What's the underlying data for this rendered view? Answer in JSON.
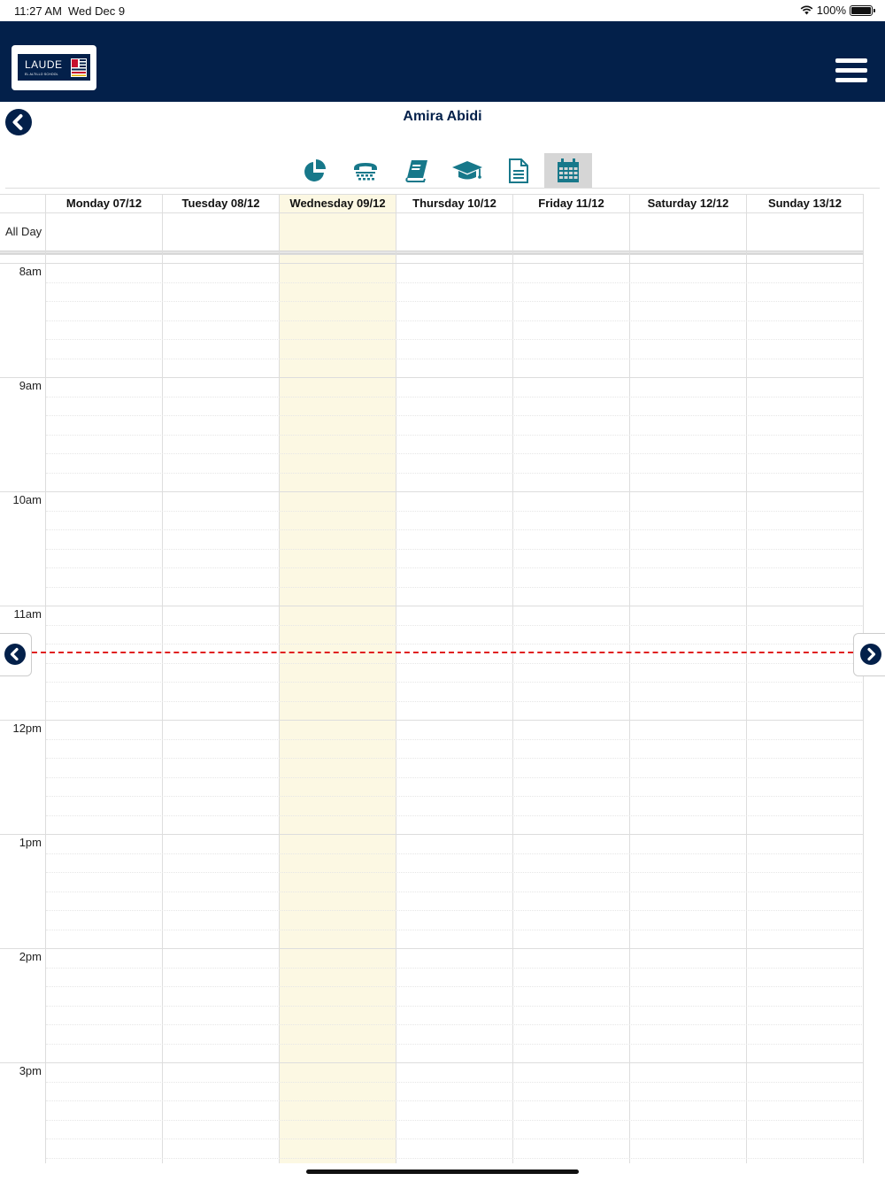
{
  "status_bar": {
    "time": "11:27 AM",
    "date": "Wed Dec 9",
    "battery": "100%",
    "battery_level": 1.0
  },
  "header": {
    "logo_text": "LAUDE",
    "logo_subtext": "EL ALTILLO SCHOOL",
    "menu_icon": "hamburger-menu-icon"
  },
  "student": {
    "name": "Amira Abidi"
  },
  "toolbar": {
    "items": [
      {
        "icon": "pie-chart-icon",
        "active": false
      },
      {
        "icon": "telephone-icon",
        "active": false
      },
      {
        "icon": "book-icon",
        "active": false
      },
      {
        "icon": "graduation-cap-icon",
        "active": false
      },
      {
        "icon": "document-icon",
        "active": false
      },
      {
        "icon": "calendar-icon",
        "active": true
      }
    ]
  },
  "calendar": {
    "days": [
      "Monday 07/12",
      "Tuesday 08/12",
      "Wednesday 09/12",
      "Thursday 10/12",
      "Friday 11/12",
      "Saturday 12/12",
      "Sunday 13/12"
    ],
    "today": "Wednesday 09/12",
    "all_day_label": "All Day",
    "hours": [
      "8am",
      "9am",
      "10am",
      "11am",
      "12pm",
      "1pm",
      "2pm",
      "3pm"
    ],
    "colors": {
      "today_highlight": "#fcf8e3",
      "now_line": "#e02020",
      "brand": "#03204a"
    }
  }
}
